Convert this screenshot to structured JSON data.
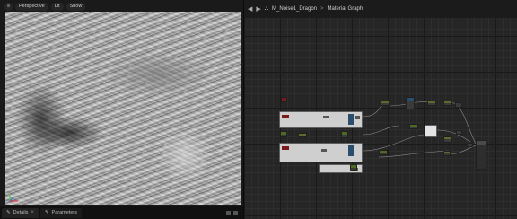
{
  "viewport": {
    "toolbar": {
      "perspective_label": "Perspective",
      "lit_label": "Lit",
      "show_label": "Show"
    },
    "tabs": [
      {
        "label": "Details"
      },
      {
        "label": "Parameters"
      }
    ]
  },
  "graph": {
    "breadcrumb": {
      "asset": "M_Noise1_Dragon",
      "separator": ">",
      "graph": "Material Graph"
    }
  },
  "colors": {
    "panel_bg": "#1a1a1a",
    "graph_bg": "#262626",
    "node_header_red": "#7a1b1b",
    "node_header_green": "#4c6b22",
    "node_header_blue": "#2c4e6e"
  }
}
